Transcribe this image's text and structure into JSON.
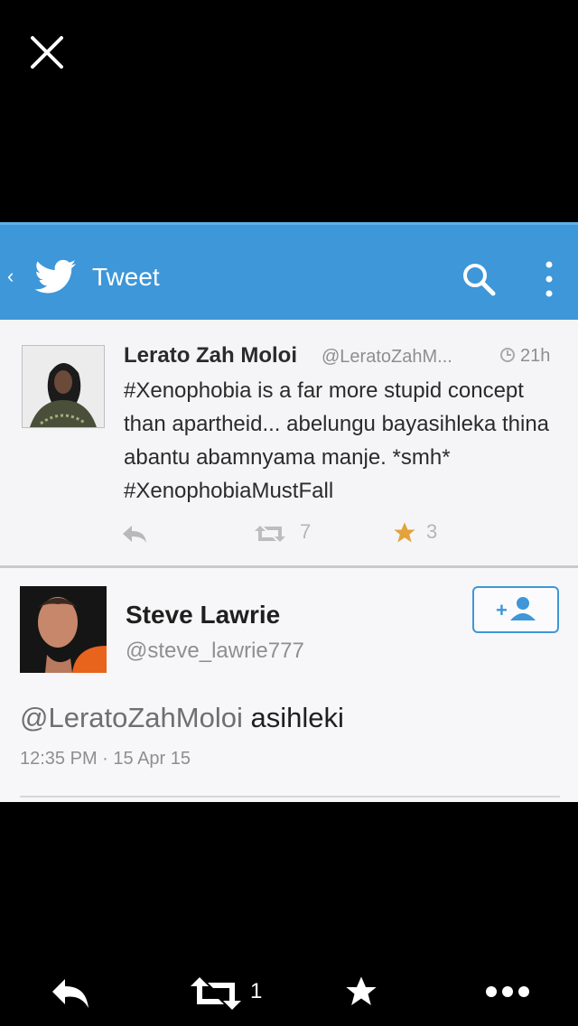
{
  "viewer": {
    "close_icon": "close-icon"
  },
  "twitter": {
    "header": {
      "title": "Tweet",
      "back_icon": "chevron-left-icon",
      "logo_icon": "twitter-bird-icon",
      "search_icon": "search-icon",
      "menu_icon": "kebab-menu-icon"
    },
    "tweet": {
      "author_name": "Lerato Zah Moloi",
      "author_handle": "@LeratoZahM...",
      "time_ago": "21h",
      "text": "#Xenophobia is a far more stupid concept than apartheid... abelungu bayasihleka thina abantu abamnyama manje. *smh* #XenophobiaMustFall",
      "retweets": "7",
      "favorites": "3"
    },
    "reply": {
      "author_name": "Steve Lawrie",
      "author_handle": "@steve_lawrie777",
      "mention": "@LeratoZahMoloi",
      "text": " asihleki",
      "timestamp": "12:35 PM · 15 Apr 15"
    }
  },
  "toolbar": {
    "retweet_count": "1"
  },
  "colors": {
    "accent": "#3d97d9",
    "star": "#e3a33a",
    "background": "#000000"
  }
}
